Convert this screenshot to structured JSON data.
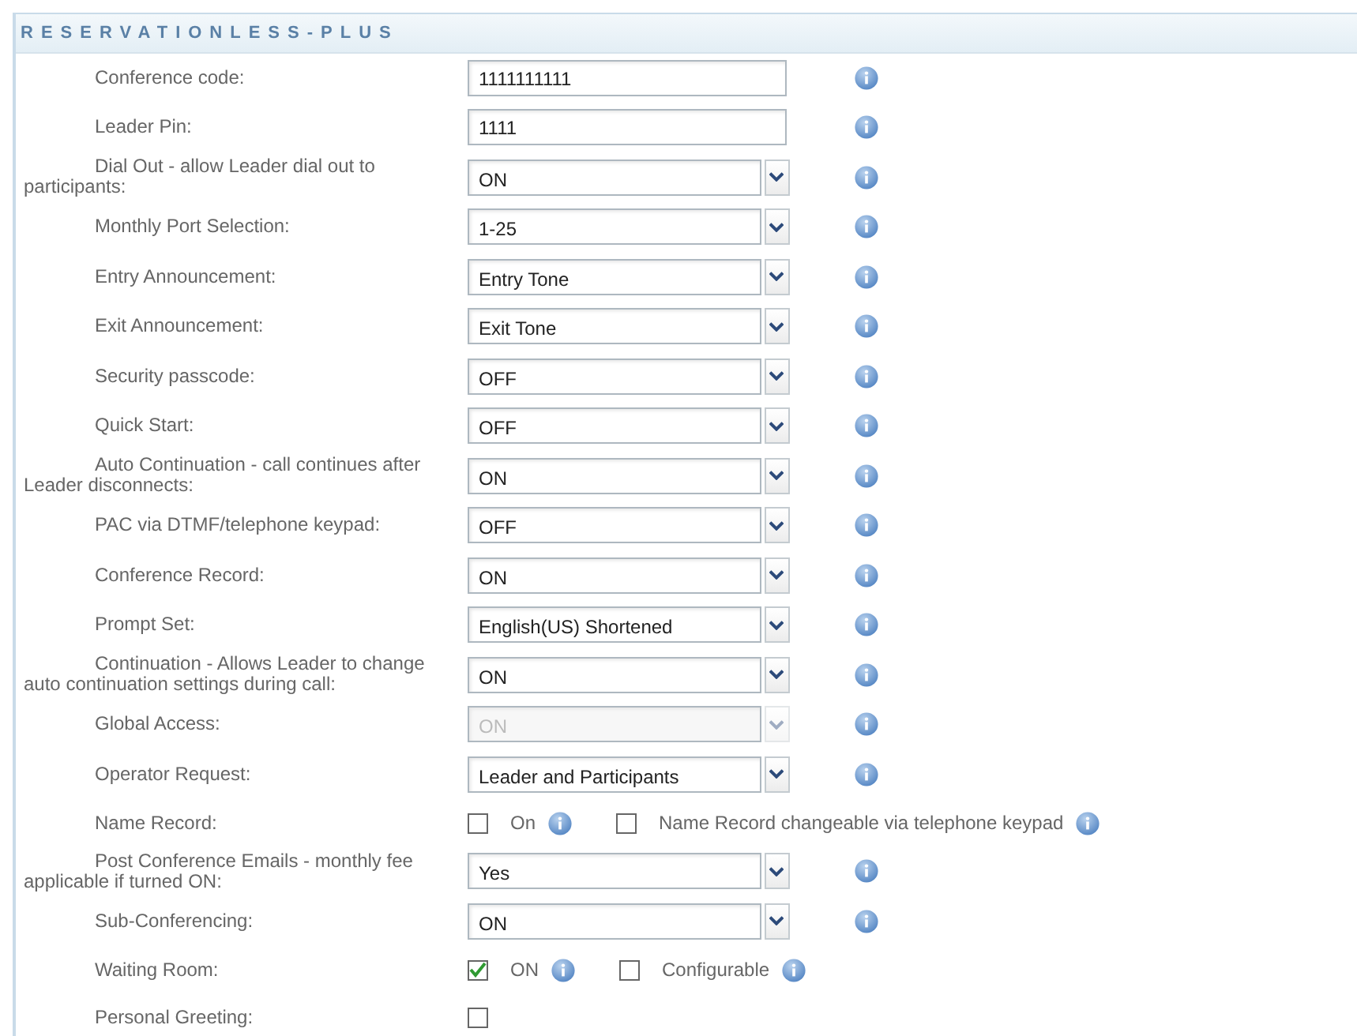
{
  "section_title": "RESERVATIONLESS-PLUS",
  "rows": [
    {
      "label": "Conference code:",
      "kind": "text",
      "value": "1111111111",
      "info": true
    },
    {
      "label": "Leader Pin:",
      "kind": "text",
      "value": "1111",
      "info": true
    },
    {
      "label": "Dial Out - allow Leader dial out to participants:",
      "kind": "select",
      "value": "ON",
      "disabled": false,
      "info": true
    },
    {
      "label": "Monthly Port Selection:",
      "kind": "select",
      "value": "1-25",
      "disabled": false,
      "info": true
    },
    {
      "label": "Entry Announcement:",
      "kind": "select",
      "value": "Entry Tone",
      "disabled": false,
      "info": true
    },
    {
      "label": "Exit Announcement:",
      "kind": "select",
      "value": "Exit Tone",
      "disabled": false,
      "info": true
    },
    {
      "label": "Security passcode:",
      "kind": "select",
      "value": "OFF",
      "disabled": false,
      "info": true
    },
    {
      "label": "Quick Start:",
      "kind": "select",
      "value": "OFF",
      "disabled": false,
      "info": true
    },
    {
      "label": "Auto Continuation - call continues after Leader disconnects:",
      "kind": "select",
      "value": "ON",
      "disabled": false,
      "info": true
    },
    {
      "label": "PAC via DTMF/telephone keypad:",
      "kind": "select",
      "value": "OFF",
      "disabled": false,
      "info": true
    },
    {
      "label": "Conference Record:",
      "kind": "select",
      "value": "ON",
      "disabled": false,
      "info": true
    },
    {
      "label": "Prompt Set:",
      "kind": "select",
      "value": "English(US) Shortened",
      "disabled": false,
      "info": true
    },
    {
      "label": "Continuation - Allows Leader to change auto continuation settings during call:",
      "kind": "select",
      "value": "ON",
      "disabled": false,
      "info": true
    },
    {
      "label": "Global Access:",
      "kind": "select",
      "value": "ON",
      "disabled": true,
      "info": true
    },
    {
      "label": "Operator Request:",
      "kind": "select",
      "value": "Leader and Participants",
      "disabled": false,
      "info": true
    },
    {
      "label": "Name Record:",
      "kind": "checks",
      "options": [
        {
          "label": "On",
          "checked": false,
          "info": true
        },
        {
          "label": "Name Record changeable via telephone keypad",
          "checked": false,
          "info": true
        }
      ]
    },
    {
      "label": "Post Conference Emails - monthly fee applicable if turned ON:",
      "kind": "select",
      "value": "Yes",
      "disabled": false,
      "info": true
    },
    {
      "label": "Sub-Conferencing:",
      "kind": "select",
      "value": "ON",
      "disabled": false,
      "info": true
    },
    {
      "label": "Waiting Room:",
      "kind": "checks",
      "options": [
        {
          "label": "ON",
          "checked": true,
          "info": true
        },
        {
          "label": "Configurable",
          "checked": false,
          "info": true
        }
      ]
    },
    {
      "label": "Personal Greeting:",
      "kind": "checks",
      "options": [
        {
          "checked": false,
          "info": false
        }
      ]
    }
  ]
}
